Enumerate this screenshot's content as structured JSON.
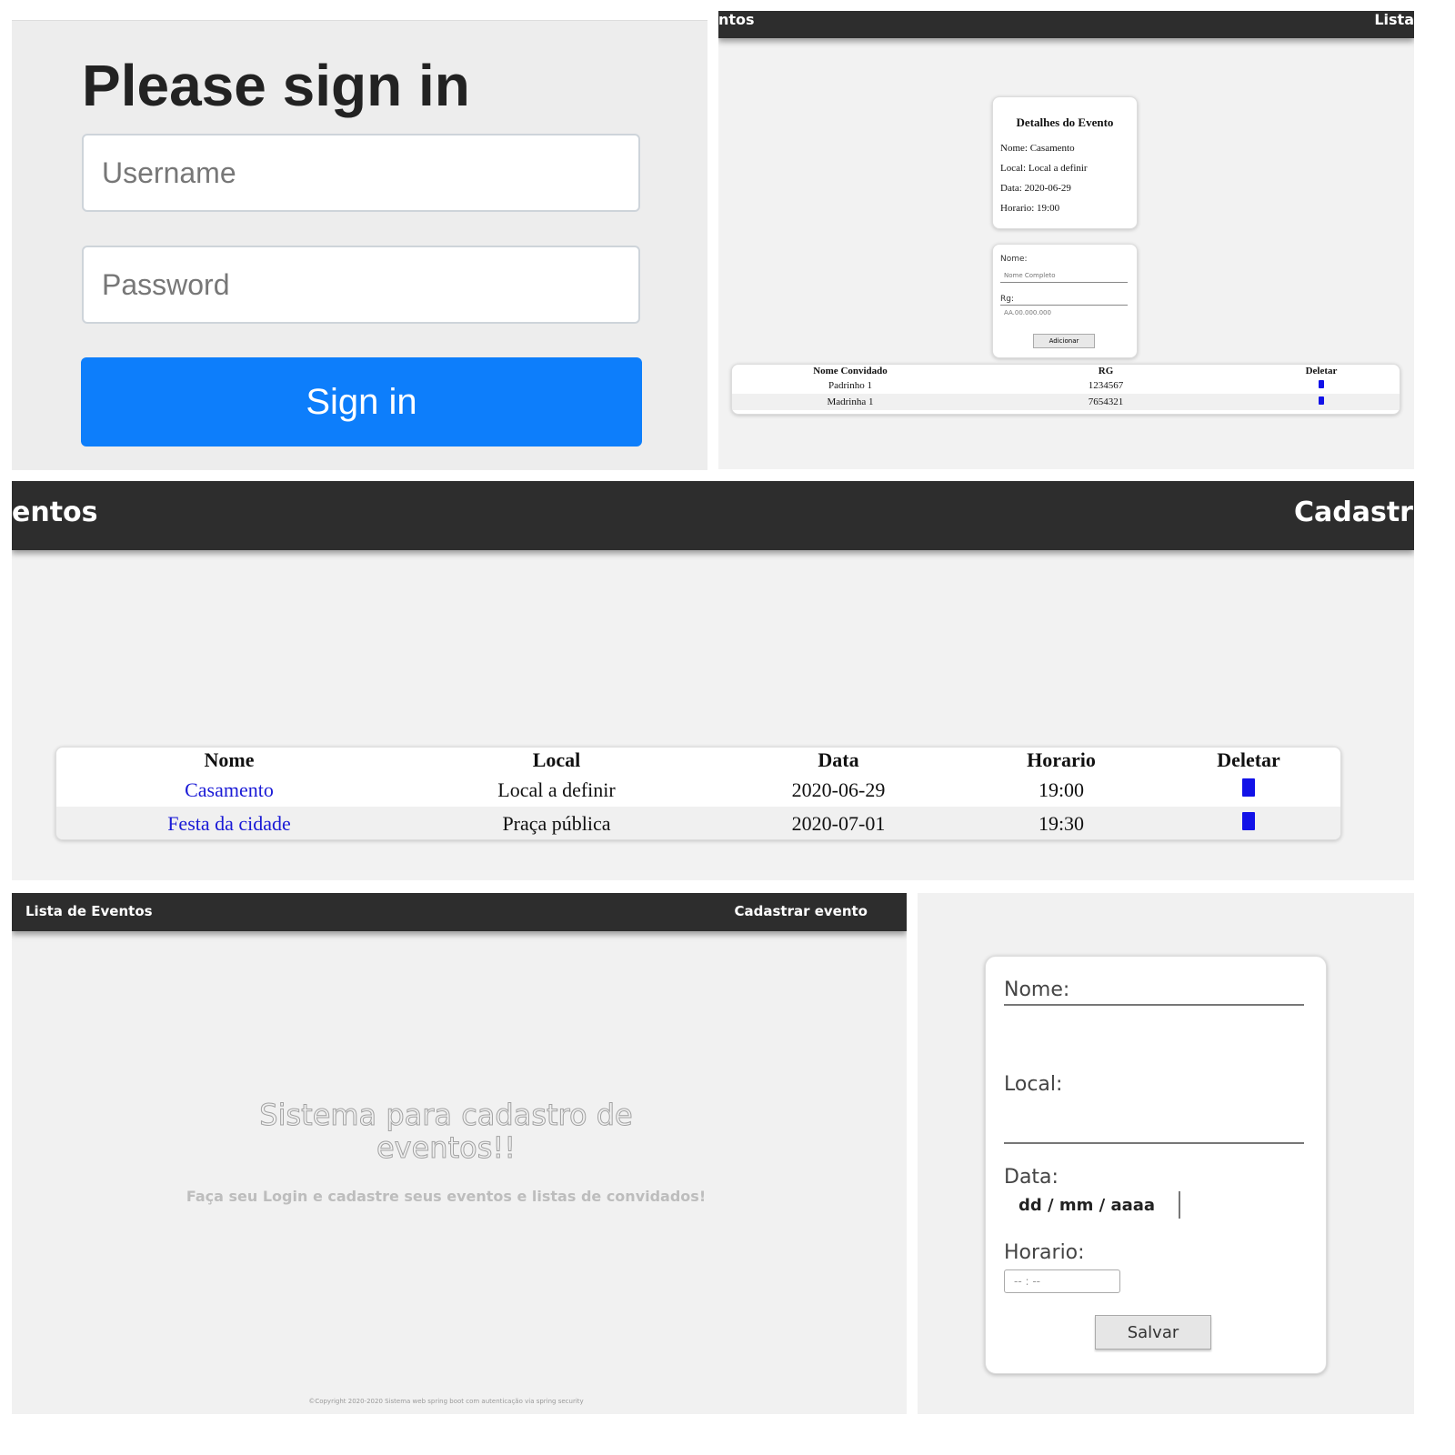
{
  "signin": {
    "title": "Please sign in",
    "username_placeholder": "Username",
    "password_placeholder": "Password",
    "button_label": "Sign in",
    "button_color": "#0d7efb"
  },
  "details": {
    "navbar": {
      "left_label": "ntos",
      "right_label": "Lista"
    },
    "card_title": "Detalhes do Evento",
    "nome": "Nome: Casamento",
    "local": "Local: Local a definir",
    "data": "Data: 2020-06-29",
    "horario": "Horario: 19:00",
    "form": {
      "nome_label": "Nome:",
      "nome_placeholder": "Nome Completo",
      "rg_label": "Rg:",
      "rg_placeholder": "AA.00.000.000",
      "button_label": "Adicionar"
    },
    "guest_table": {
      "headers": [
        "Nome Convidado",
        "RG",
        "Deletar"
      ],
      "rows": [
        {
          "nome": "Padrinho 1",
          "rg": "1234567",
          "delete_icon": "trash-icon"
        },
        {
          "nome": "Madrinha 1",
          "rg": "7654321",
          "delete_icon": "trash-icon"
        }
      ]
    }
  },
  "list": {
    "navbar": {
      "left_label": "entos",
      "right_label": "Cadastr"
    },
    "table": {
      "headers": [
        "Nome",
        "Local",
        "Data",
        "Horario",
        "Deletar"
      ],
      "rows": [
        {
          "nome": "Casamento",
          "local": "Local a definir",
          "data": "2020-06-29",
          "horario": "19:00",
          "delete_icon": "trash-icon"
        },
        {
          "nome": "Festa da cidade",
          "local": "Praça pública",
          "data": "2020-07-01",
          "horario": "19:30",
          "delete_icon": "trash-icon"
        }
      ]
    },
    "link_color": "#1a1ad6",
    "trash_color": "#1212e8"
  },
  "home": {
    "navbar": {
      "left_label": "Lista de Eventos",
      "right_label": "Cadastrar evento"
    },
    "hero_title": "Sistema para cadastro de eventos!!",
    "hero_subtitle": "Faça seu Login e cadastre seus eventos e listas de convidados!",
    "footer": "©Copyright 2020-2020 Sistema web spring boot com autenticação via spring security"
  },
  "create": {
    "nome_label": "Nome:",
    "local_label": "Local:",
    "data_label": "Data:",
    "data_value": "dd / mm / aaaa",
    "horario_label": "Horario:",
    "horario_value": "-- : --",
    "button_label": "Salvar"
  },
  "colors": {
    "navbar_bg": "#2d2d2d",
    "page_bg": "#f2f2f2"
  }
}
